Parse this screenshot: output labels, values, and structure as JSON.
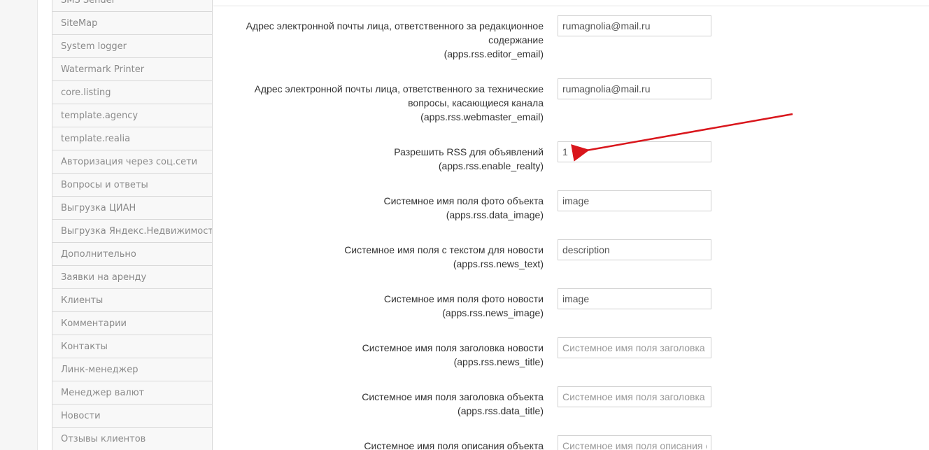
{
  "sidebar": {
    "items": [
      {
        "label": "SMS Sender"
      },
      {
        "label": "SiteMap"
      },
      {
        "label": "System logger"
      },
      {
        "label": "Watermark Printer"
      },
      {
        "label": "core.listing"
      },
      {
        "label": "template.agency"
      },
      {
        "label": "template.realia"
      },
      {
        "label": "Авторизация через соц.сети"
      },
      {
        "label": "Вопросы и ответы"
      },
      {
        "label": "Выгрузка ЦИАН"
      },
      {
        "label": "Выгрузка Яндекс.Недвижимость"
      },
      {
        "label": "Дополнительно"
      },
      {
        "label": "Заявки на аренду"
      },
      {
        "label": "Клиенты"
      },
      {
        "label": "Комментарии"
      },
      {
        "label": "Контакты"
      },
      {
        "label": "Линк-менеджер"
      },
      {
        "label": "Менеджер валют"
      },
      {
        "label": "Новости"
      },
      {
        "label": "Отзывы клиентов"
      }
    ]
  },
  "settings": [
    {
      "label_lines": [
        "Адрес электронной почты лица, ответственного за редакционное",
        "содержание"
      ],
      "key": "(apps.rss.editor_email)",
      "value": "rumagnolia@mail.ru",
      "placeholder": ""
    },
    {
      "label_lines": [
        "Адрес электронной почты лица, ответственного за технические",
        "вопросы, касающиеся канала"
      ],
      "key": "(apps.rss.webmaster_email)",
      "value": "rumagnolia@mail.ru",
      "placeholder": ""
    },
    {
      "label_lines": [
        "Разрешить RSS для объявлений"
      ],
      "key": "(apps.rss.enable_realty)",
      "value": "1",
      "placeholder": ""
    },
    {
      "label_lines": [
        "Системное имя поля фото объекта"
      ],
      "key": "(apps.rss.data_image)",
      "value": "image",
      "placeholder": ""
    },
    {
      "label_lines": [
        "Системное имя поля с текстом для новости"
      ],
      "key": "(apps.rss.news_text)",
      "value": "description",
      "placeholder": ""
    },
    {
      "label_lines": [
        "Системное имя поля фото новости"
      ],
      "key": "(apps.rss.news_image)",
      "value": "image",
      "placeholder": ""
    },
    {
      "label_lines": [
        "Системное имя поля заголовка новости"
      ],
      "key": "(apps.rss.news_title)",
      "value": "",
      "placeholder": "Системное имя поля заголовка"
    },
    {
      "label_lines": [
        "Системное имя поля заголовка объекта"
      ],
      "key": "(apps.rss.data_title)",
      "value": "",
      "placeholder": "Системное имя поля заголовка"
    },
    {
      "label_lines": [
        "Системное имя поля описания объекта"
      ],
      "key": "",
      "value": "",
      "placeholder": "Системное имя поля описания о"
    }
  ],
  "annotation": {
    "color": "#d9161c"
  }
}
